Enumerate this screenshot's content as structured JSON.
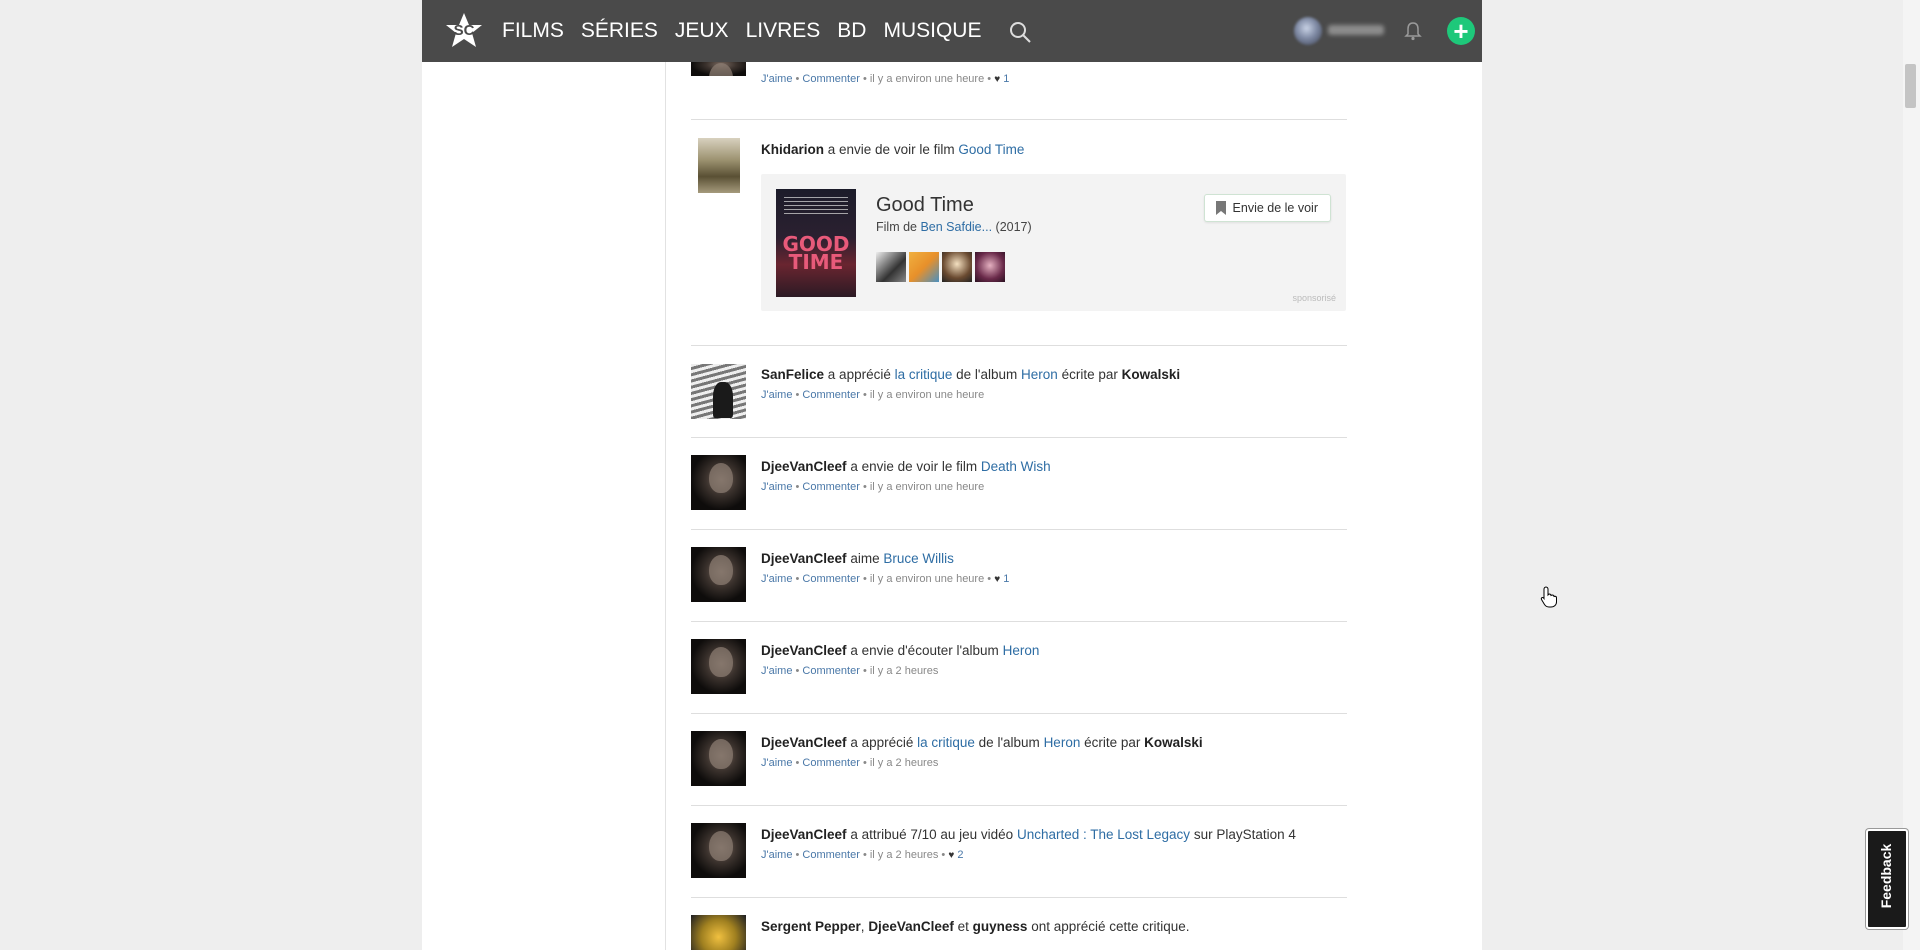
{
  "nav": {
    "logo_text": "SC",
    "links": [
      "FILMS",
      "SÉRIES",
      "JEUX",
      "LIVRES",
      "BD",
      "MUSIQUE"
    ],
    "plus_label": "+"
  },
  "feed": {
    "top_meta": {
      "like": "J'aime",
      "comment": "Commenter",
      "time": "il y a environ une heure",
      "likes": "1"
    },
    "item_khid": {
      "user": "Khidarion",
      "action": "a envie de voir le film",
      "target": "Good Time",
      "card": {
        "title": "Good Time",
        "sub_prefix": "Film de",
        "director": "Ben Safdie...",
        "year": "(2017)",
        "poster_text": "GOOD TIME",
        "button": "Envie de le voir",
        "sponsored": "sponsorisé"
      }
    },
    "items": [
      {
        "user": "SanFelice",
        "a1": "a apprécié",
        "l1": "la critique",
        "a2": "de l'album",
        "l2": "Heron",
        "a3": "écrite par",
        "b2": "Kowalski",
        "meta": {
          "like": "J'aime",
          "comment": "Commenter",
          "time": "il y a environ une heure"
        }
      },
      {
        "user": "DjeeVanCleef",
        "a1": "a envie de voir le film",
        "l1": "Death Wish",
        "meta": {
          "like": "J'aime",
          "comment": "Commenter",
          "time": "il y a environ une heure"
        }
      },
      {
        "user": "DjeeVanCleef",
        "a1": "aime",
        "l1": "Bruce Willis",
        "meta": {
          "like": "J'aime",
          "comment": "Commenter",
          "time": "il y a environ une heure",
          "likes": "1"
        }
      },
      {
        "user": "DjeeVanCleef",
        "a1": "a envie d'écouter l'album",
        "l1": "Heron",
        "meta": {
          "like": "J'aime",
          "comment": "Commenter",
          "time": "il y a 2 heures"
        }
      },
      {
        "user": "DjeeVanCleef",
        "a1": "a apprécié",
        "l1": "la critique",
        "a2": "de l'album",
        "l2": "Heron",
        "a3": "écrite par",
        "b2": "Kowalski",
        "meta": {
          "like": "J'aime",
          "comment": "Commenter",
          "time": "il y a 2 heures"
        }
      },
      {
        "user": "DjeeVanCleef",
        "a1": "a attribué 7/10 au jeu vidéo",
        "l1": "Uncharted : The Lost Legacy",
        "a2": "sur PlayStation 4",
        "meta": {
          "like": "J'aime",
          "comment": "Commenter",
          "time": "il y a 2 heures",
          "likes": "2"
        }
      },
      {
        "user": "Sergent Pepper",
        "sep": ",",
        "b2": "DjeeVanCleef",
        "a2": "et",
        "b3": "guyness",
        "a3": "ont apprécié cette critique."
      }
    ]
  },
  "feedback_label": "Feedback"
}
